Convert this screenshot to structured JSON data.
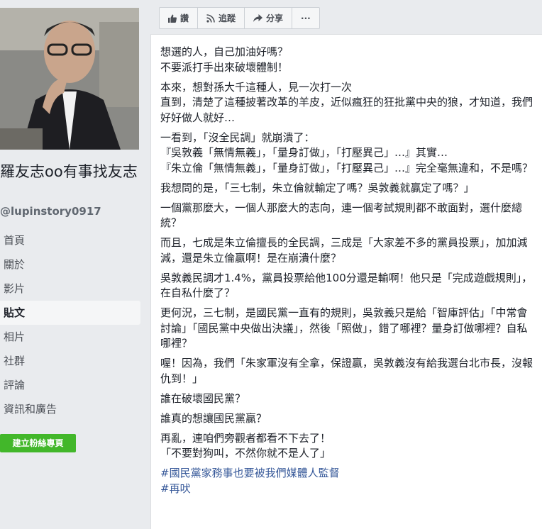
{
  "page": {
    "name": "羅友志oo有事找友志",
    "handle": "@lupinstory0917"
  },
  "nav": [
    {
      "label": "首頁",
      "active": false
    },
    {
      "label": "關於",
      "active": false
    },
    {
      "label": "影片",
      "active": false
    },
    {
      "label": "貼文",
      "active": true
    },
    {
      "label": "相片",
      "active": false
    },
    {
      "label": "社群",
      "active": false
    },
    {
      "label": "評論",
      "active": false
    },
    {
      "label": "資訊和廣告",
      "active": false
    }
  ],
  "create_button": "建立粉絲專頁",
  "actions": {
    "like": "讚",
    "follow": "追蹤",
    "share": "分享",
    "more": "···"
  },
  "post": {
    "paragraphs": [
      [
        "想選的人，自己加油好嗎？",
        "不要派打手出來破壞體制！"
      ],
      [
        "本來，想對孫大千這種人，見一次打一次",
        "直到，清楚了這種披著改革的羊皮，近似瘋狂的狂批黨中央的狼，才知道，我們好好做人就好…"
      ],
      [
        "一看到，「沒全民調」就崩潰了：",
        "『吳敦義「無情無義」，「量身訂做」，「打壓異己」…』其實…",
        "『朱立倫「無情無義」，「量身訂做」，「打壓異己」…』完全毫無違和，不是嗎？"
      ],
      [
        "我想問的是，「三七制，朱立倫就輸定了嗎？吳敦義就贏定了嗎？」"
      ],
      [
        "一個黨那麼大，一個人那麼大的志向，連一個考試規則都不敢面對，選什麼總統？"
      ],
      [
        "而且，七成是朱立倫擅長的全民調，三成是「大家差不多的黨員投票」，加加減減，還是朱立倫贏啊！是在崩潰什麼？"
      ],
      [
        "吳敦義民調才1.4%，黨員投票給他100分還是輸啊！他只是「完成遊戲規則」，在自私什麼了？"
      ],
      [
        "更何況，三七制，是國民黨一直有的規則，吳敦義只是給「智庫評估」「中常會討論」「國民黨中央做出決議」，然後「照做」，錯了哪裡？量身訂做哪裡？自私哪裡？"
      ],
      [
        "喔！因為，我們「朱家軍沒有全拿，保證贏，吳敦義沒有給我選台北市長，沒報仇到！」"
      ],
      [
        "誰在破壞國民黨？"
      ],
      [
        "誰真的想讓國民黨贏？"
      ],
      [
        "再亂，連咱們旁觀者都看不下去了！",
        "「不要對狗叫，不然你就不是人了」"
      ]
    ],
    "hashtags": [
      "#國民黨家務事也要被我們媒體人監督",
      "#再吠"
    ]
  }
}
